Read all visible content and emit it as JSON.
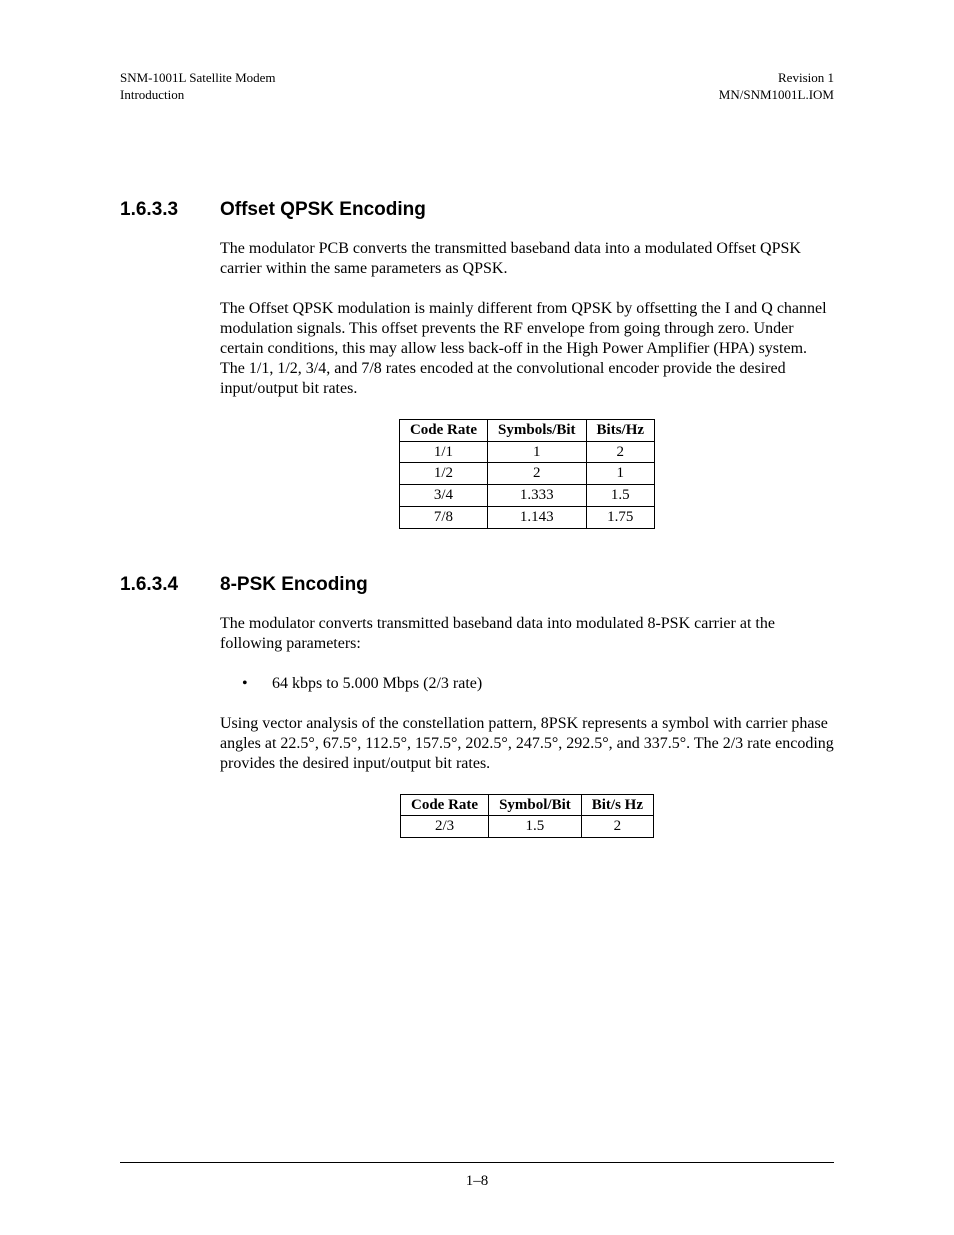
{
  "header": {
    "left_line1": "SNM-1001L Satellite Modem",
    "left_line2": "Introduction",
    "right_line1": "Revision 1",
    "right_line2": "MN/SNM1001L.IOM"
  },
  "section1": {
    "number": "1.6.3.3",
    "title": "Offset QPSK Encoding",
    "para1": "The modulator PCB converts the transmitted baseband data into a modulated Offset QPSK carrier within the same parameters as QPSK.",
    "para2": "The Offset QPSK modulation is mainly different from QPSK by offsetting the I and Q channel modulation signals. This offset prevents the RF envelope from going through zero. Under certain conditions, this may allow less back-off in the High Power Amplifier (HPA) system. The 1/1, 1/2, 3/4, and 7/8 rates encoded at the convolutional encoder provide the desired input/output bit rates.",
    "table": {
      "headers": [
        "Code Rate",
        "Symbols/Bit",
        "Bits/Hz"
      ],
      "rows": [
        [
          "1/1",
          "1",
          "2"
        ],
        [
          "1/2",
          "2",
          "1"
        ],
        [
          "3/4",
          "1.333",
          "1.5"
        ],
        [
          "7/8",
          "1.143",
          "1.75"
        ]
      ]
    }
  },
  "section2": {
    "number": "1.6.3.4",
    "title": "8-PSK Encoding",
    "para1": "The modulator converts transmitted baseband data into modulated 8-PSK carrier at the following parameters:",
    "bullet1": "64 kbps to 5.000 Mbps (2/3 rate)",
    "para2": "Using vector analysis of the constellation pattern, 8PSK represents a symbol with carrier phase angles at 22.5°, 67.5°, 112.5°, 157.5°, 202.5°, 247.5°, 292.5°, and 337.5°. The 2/3 rate encoding provides the desired input/output bit rates.",
    "table": {
      "headers": [
        "Code Rate",
        "Symbol/Bit",
        "Bit/s Hz"
      ],
      "rows": [
        [
          "2/3",
          "1.5",
          "2"
        ]
      ]
    }
  },
  "footer": {
    "page": "1–8"
  }
}
